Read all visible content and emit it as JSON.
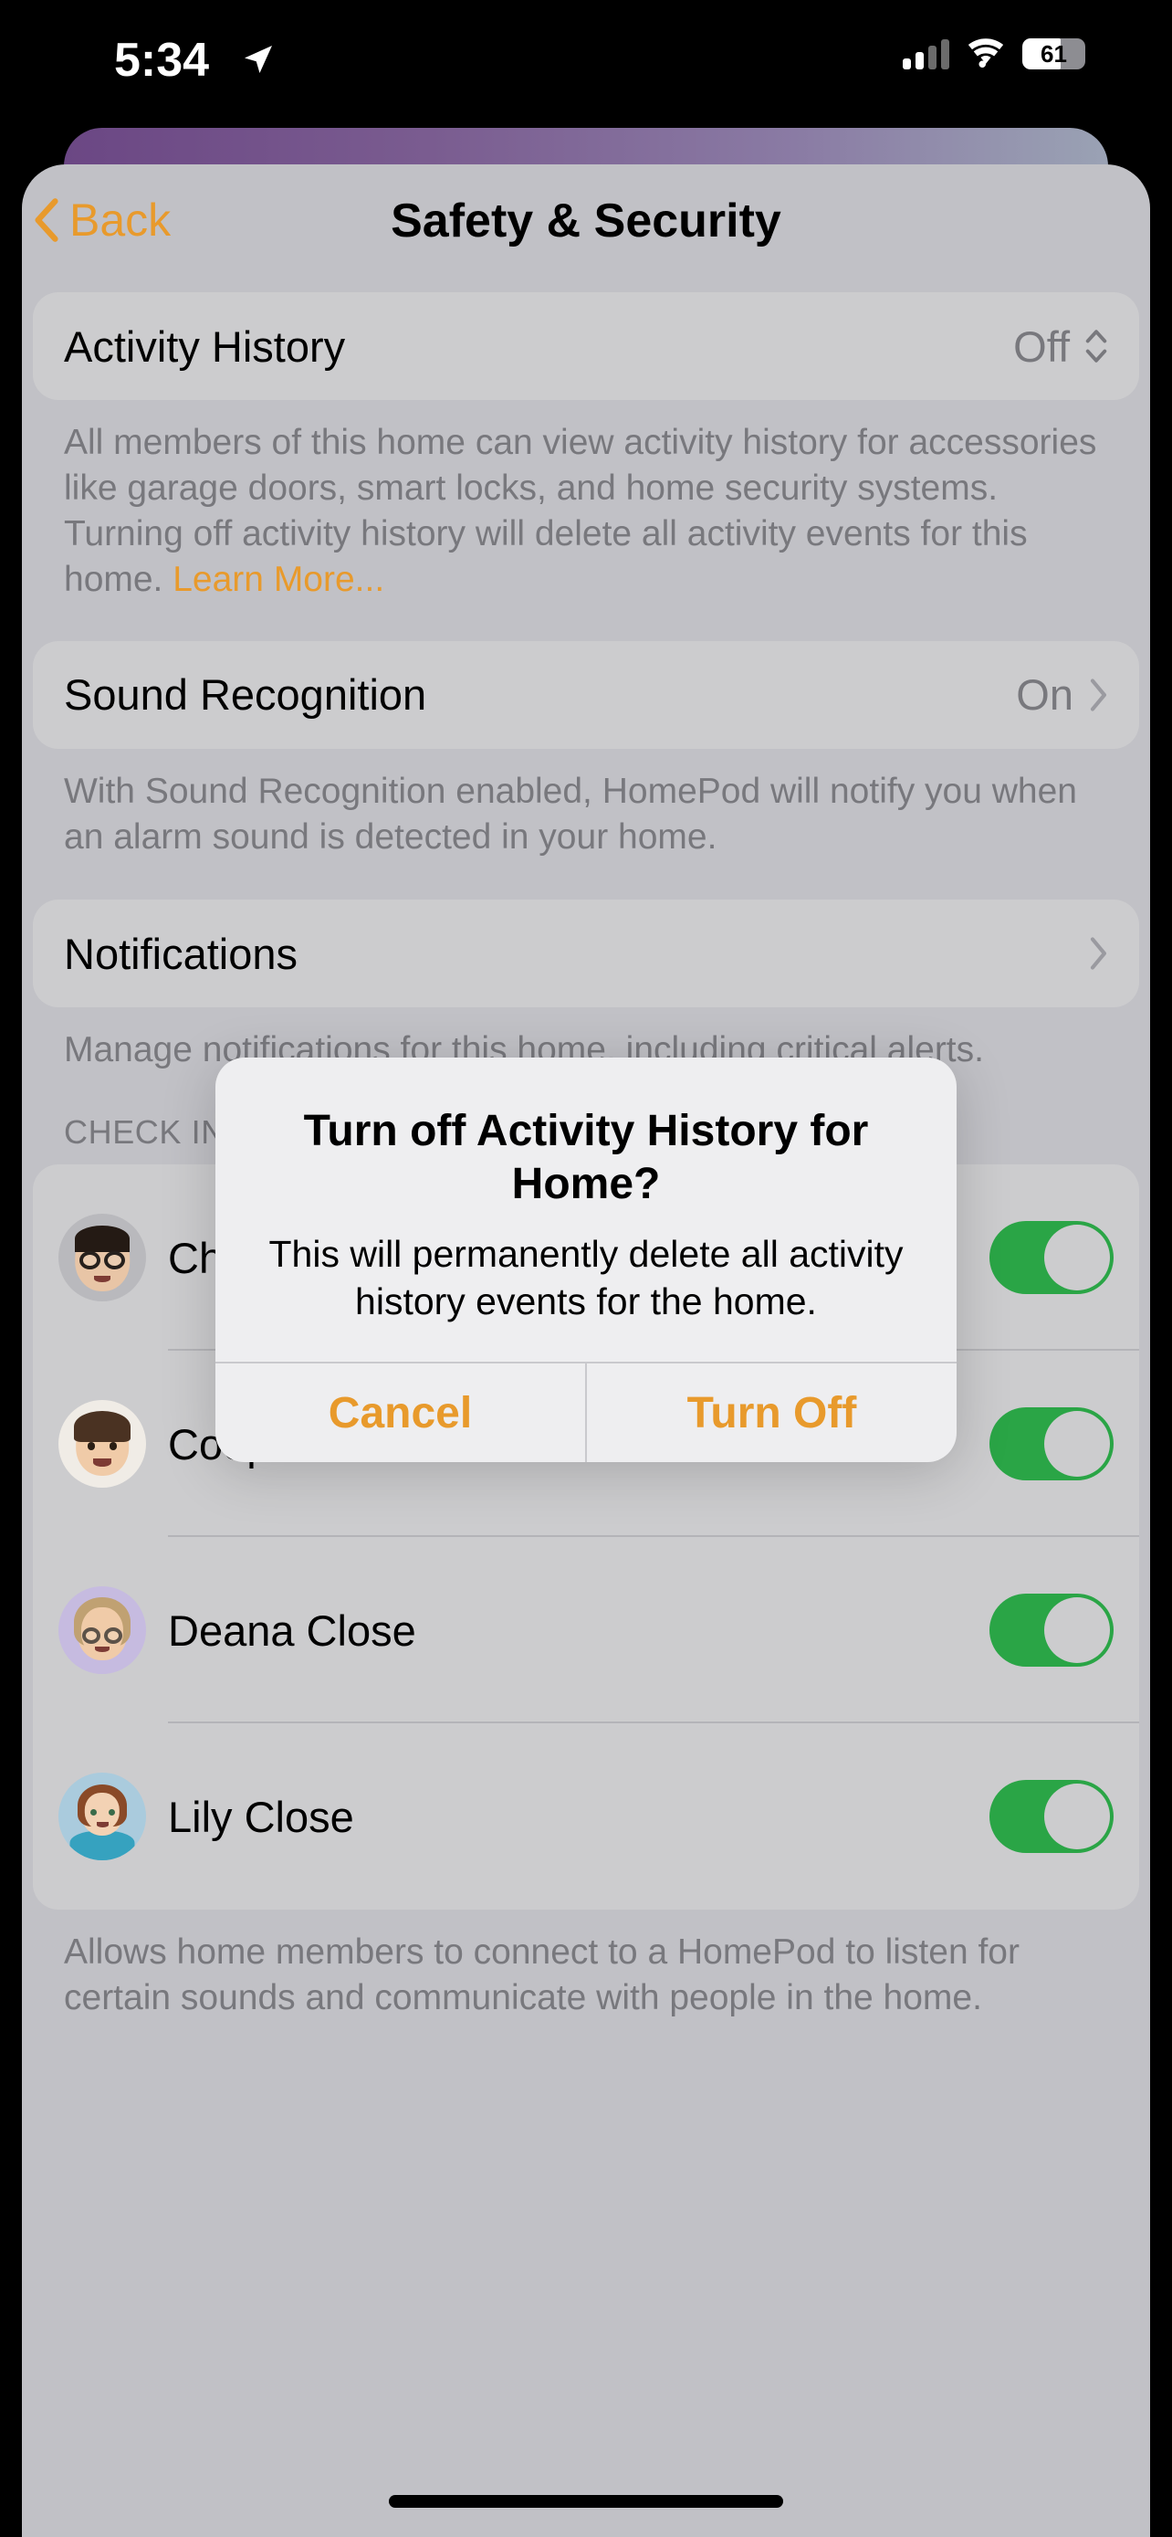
{
  "status_bar": {
    "time": "5:34",
    "location_icon": "location-arrow-icon",
    "cellular_icon": "cellular-bars-icon",
    "wifi_icon": "wifi-icon",
    "battery_percent": "61",
    "battery_icon": "battery-icon"
  },
  "nav": {
    "back_label": "Back",
    "back_icon": "chevron-left-icon",
    "title": "Safety & Security"
  },
  "sections": {
    "activity_history": {
      "label": "Activity History",
      "value": "Off",
      "control_icon": "chevron-up-down-icon",
      "footer": "All members of this home can view activity history for accessories like garage doors, smart locks, and home security systems. Turning off activity history will delete all activity events for this home. ",
      "footer_link": "Learn More..."
    },
    "sound_recognition": {
      "label": "Sound Recognition",
      "value": "On",
      "control_icon": "chevron-right-icon",
      "footer": "With Sound Recognition enabled, HomePod will notify you when an alarm sound is detected in your home."
    },
    "notifications": {
      "label": "Notifications",
      "control_icon": "chevron-right-icon",
      "footer": "Manage notifications for this home, including critical alerts."
    },
    "check_in": {
      "header": "CHECK IN",
      "footer": "Allows home members to connect to a HomePod to listen for certain sounds and communicate with people in the home.",
      "people": [
        {
          "name": "Christopher Close",
          "toggle": "on",
          "avatar": "memoji-christopher"
        },
        {
          "name": "Cooper Close",
          "toggle": "on",
          "avatar": "memoji-cooper"
        },
        {
          "name": "Deana Close",
          "toggle": "on",
          "avatar": "memoji-deana"
        },
        {
          "name": "Lily Close",
          "toggle": "on",
          "avatar": "memoji-lily"
        }
      ]
    }
  },
  "alert": {
    "title": "Turn off Activity History for Home?",
    "message": "This will permanently delete all activity history events for the home.",
    "cancel_label": "Cancel",
    "confirm_label": "Turn Off"
  },
  "colors": {
    "accent_orange": "#e89a2c",
    "toggle_green": "#2aa546",
    "page_bg": "#c1c1c6",
    "card_bg": "#ccccce",
    "secondary_text": "#78787d"
  }
}
